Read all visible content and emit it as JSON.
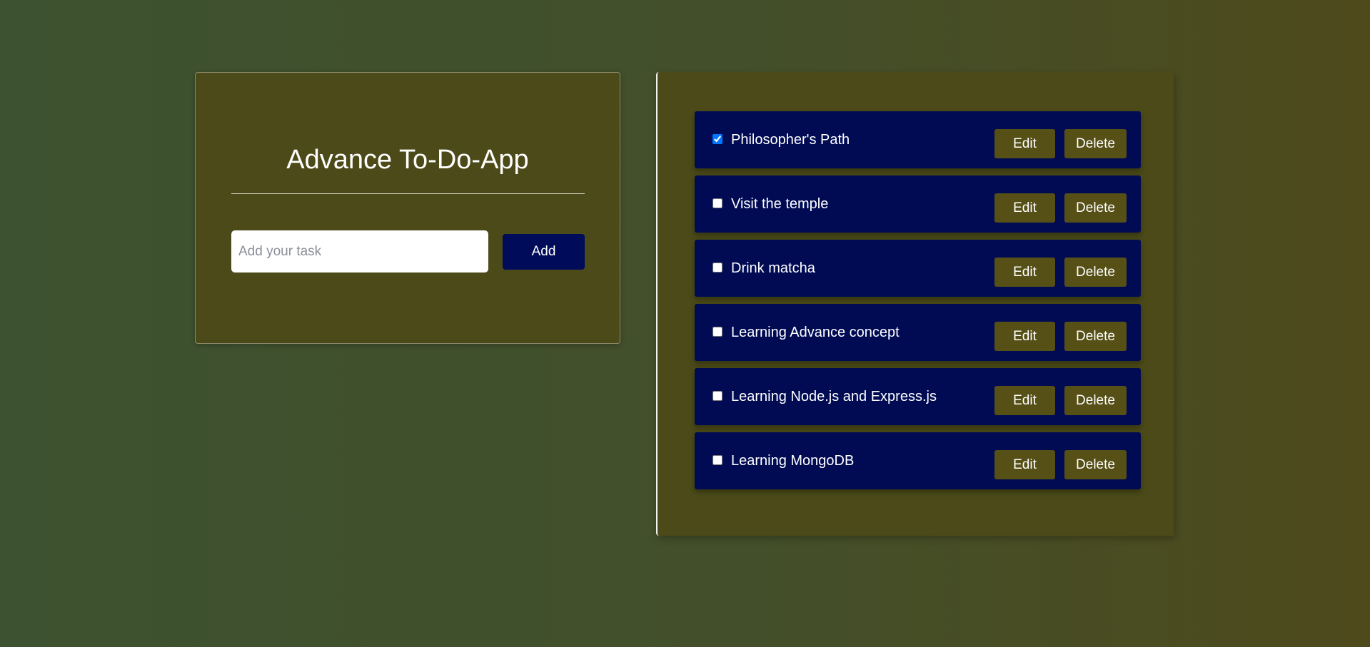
{
  "app": {
    "title": "Advance To-Do-App",
    "input_placeholder": "Add your task",
    "input_value": "",
    "add_label": "Add"
  },
  "tasks": [
    {
      "text": "Philosopher's Path",
      "done": true,
      "edit_label": "Edit",
      "delete_label": "Delete"
    },
    {
      "text": "Visit the temple",
      "done": false,
      "edit_label": "Edit",
      "delete_label": "Delete"
    },
    {
      "text": "Drink matcha",
      "done": false,
      "edit_label": "Edit",
      "delete_label": "Delete"
    },
    {
      "text": "Learning Advance concept",
      "done": false,
      "edit_label": "Edit",
      "delete_label": "Delete"
    },
    {
      "text": "Learning Node.js and Express.js",
      "done": false,
      "edit_label": "Edit",
      "delete_label": "Delete"
    },
    {
      "text": "Learning MongoDB",
      "done": false,
      "edit_label": "Edit",
      "delete_label": "Delete"
    }
  ],
  "colors": {
    "card_background": "#4b4a18",
    "task_background": "#000b54",
    "add_button": "#000c5a",
    "task_button": "#565017"
  }
}
